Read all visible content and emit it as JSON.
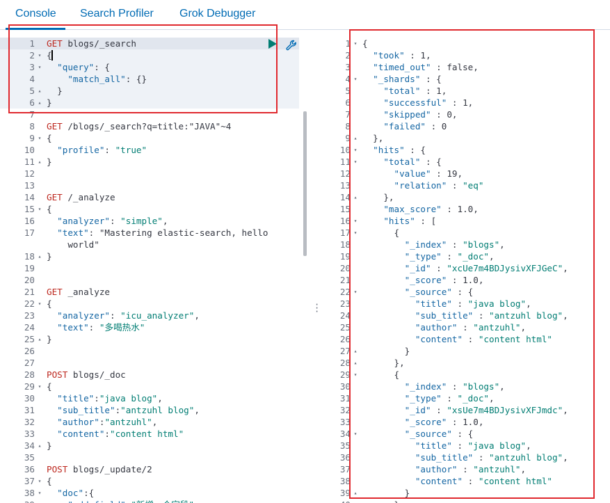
{
  "tabs": [
    {
      "label": "Console",
      "active": true
    },
    {
      "label": "Search Profiler",
      "active": false
    },
    {
      "label": "Grok Debugger",
      "active": false
    }
  ],
  "request_actions": {
    "run_icon": "play-icon",
    "settings_icon": "wrench-icon"
  },
  "colors": {
    "accent": "#006bb4",
    "method": "#bd271e",
    "string": "#017d73",
    "key": "#1466a3",
    "highlight_box": "#e0282e"
  },
  "editor": {
    "lines": [
      {
        "n": "1",
        "fold": "",
        "text": "GET blogs/_search"
      },
      {
        "n": "2",
        "fold": "▾",
        "text": "{"
      },
      {
        "n": "3",
        "fold": "▾",
        "text": "  \"query\": {"
      },
      {
        "n": "4",
        "fold": "",
        "text": "    \"match_all\": {}"
      },
      {
        "n": "5",
        "fold": "▴",
        "text": "  }"
      },
      {
        "n": "6",
        "fold": "▴",
        "text": "}"
      },
      {
        "n": "7",
        "fold": "",
        "text": ""
      },
      {
        "n": "8",
        "fold": "",
        "text": "GET /blogs/_search?q=title:\"JAVA\"~4"
      },
      {
        "n": "9",
        "fold": "▾",
        "text": "{"
      },
      {
        "n": "10",
        "fold": "",
        "text": "  \"profile\": \"true\""
      },
      {
        "n": "11",
        "fold": "▴",
        "text": "}"
      },
      {
        "n": "12",
        "fold": "",
        "text": ""
      },
      {
        "n": "13",
        "fold": "",
        "text": ""
      },
      {
        "n": "14",
        "fold": "",
        "text": "GET /_analyze"
      },
      {
        "n": "15",
        "fold": "▾",
        "text": "{"
      },
      {
        "n": "16",
        "fold": "",
        "text": "  \"analyzer\": \"simple\","
      },
      {
        "n": "17",
        "fold": "",
        "text": "  \"text\": \"Mastering elastic-search, hello"
      },
      {
        "n": "",
        "fold": "",
        "text": "    world\""
      },
      {
        "n": "18",
        "fold": "▴",
        "text": "}"
      },
      {
        "n": "19",
        "fold": "",
        "text": ""
      },
      {
        "n": "20",
        "fold": "",
        "text": ""
      },
      {
        "n": "21",
        "fold": "",
        "text": "GET _analyze"
      },
      {
        "n": "22",
        "fold": "▾",
        "text": "{"
      },
      {
        "n": "23",
        "fold": "",
        "text": "  \"analyzer\": \"icu_analyzer\","
      },
      {
        "n": "24",
        "fold": "",
        "text": "  \"text\": \"多喝热水\""
      },
      {
        "n": "25",
        "fold": "▴",
        "text": "}"
      },
      {
        "n": "26",
        "fold": "",
        "text": ""
      },
      {
        "n": "27",
        "fold": "",
        "text": ""
      },
      {
        "n": "28",
        "fold": "",
        "text": "POST blogs/_doc"
      },
      {
        "n": "29",
        "fold": "▾",
        "text": "{"
      },
      {
        "n": "30",
        "fold": "",
        "text": "  \"title\":\"java blog\","
      },
      {
        "n": "31",
        "fold": "",
        "text": "  \"sub_title\":\"antzuhl blog\","
      },
      {
        "n": "32",
        "fold": "",
        "text": "  \"author\":\"antzuhl\","
      },
      {
        "n": "33",
        "fold": "",
        "text": "  \"content\":\"content html\""
      },
      {
        "n": "34",
        "fold": "▴",
        "text": "}"
      },
      {
        "n": "35",
        "fold": "",
        "text": ""
      },
      {
        "n": "36",
        "fold": "",
        "text": "POST blogs/_update/2"
      },
      {
        "n": "37",
        "fold": "▾",
        "text": "{"
      },
      {
        "n": "38",
        "fold": "▾",
        "text": "  \"doc\":{"
      },
      {
        "n": "39",
        "fold": "",
        "text": "    \"add_field\":\"新增一个字段\""
      }
    ]
  },
  "response": {
    "lines": [
      {
        "n": "1",
        "fold": "▾",
        "text": "{"
      },
      {
        "n": "2",
        "fold": "",
        "text": "  \"took\" : 1,"
      },
      {
        "n": "3",
        "fold": "",
        "text": "  \"timed_out\" : false,"
      },
      {
        "n": "4",
        "fold": "▾",
        "text": "  \"_shards\" : {"
      },
      {
        "n": "5",
        "fold": "",
        "text": "    \"total\" : 1,"
      },
      {
        "n": "6",
        "fold": "",
        "text": "    \"successful\" : 1,"
      },
      {
        "n": "7",
        "fold": "",
        "text": "    \"skipped\" : 0,"
      },
      {
        "n": "8",
        "fold": "",
        "text": "    \"failed\" : 0"
      },
      {
        "n": "9",
        "fold": "▴",
        "text": "  },"
      },
      {
        "n": "10",
        "fold": "▾",
        "text": "  \"hits\" : {"
      },
      {
        "n": "11",
        "fold": "▾",
        "text": "    \"total\" : {"
      },
      {
        "n": "12",
        "fold": "",
        "text": "      \"value\" : 19,"
      },
      {
        "n": "13",
        "fold": "",
        "text": "      \"relation\" : \"eq\""
      },
      {
        "n": "14",
        "fold": "▴",
        "text": "    },"
      },
      {
        "n": "15",
        "fold": "",
        "text": "    \"max_score\" : 1.0,"
      },
      {
        "n": "16",
        "fold": "▾",
        "text": "    \"hits\" : ["
      },
      {
        "n": "17",
        "fold": "▾",
        "text": "      {"
      },
      {
        "n": "18",
        "fold": "",
        "text": "        \"_index\" : \"blogs\","
      },
      {
        "n": "19",
        "fold": "",
        "text": "        \"_type\" : \"_doc\","
      },
      {
        "n": "20",
        "fold": "",
        "text": "        \"_id\" : \"xcUe7m4BDJysivXFJGeC\","
      },
      {
        "n": "21",
        "fold": "",
        "text": "        \"_score\" : 1.0,"
      },
      {
        "n": "22",
        "fold": "▾",
        "text": "        \"_source\" : {"
      },
      {
        "n": "23",
        "fold": "",
        "text": "          \"title\" : \"java blog\","
      },
      {
        "n": "24",
        "fold": "",
        "text": "          \"sub_title\" : \"antzuhl blog\","
      },
      {
        "n": "25",
        "fold": "",
        "text": "          \"author\" : \"antzuhl\","
      },
      {
        "n": "26",
        "fold": "",
        "text": "          \"content\" : \"content html\""
      },
      {
        "n": "27",
        "fold": "▴",
        "text": "        }"
      },
      {
        "n": "28",
        "fold": "▴",
        "text": "      },"
      },
      {
        "n": "29",
        "fold": "▾",
        "text": "      {"
      },
      {
        "n": "30",
        "fold": "",
        "text": "        \"_index\" : \"blogs\","
      },
      {
        "n": "31",
        "fold": "",
        "text": "        \"_type\" : \"_doc\","
      },
      {
        "n": "32",
        "fold": "",
        "text": "        \"_id\" : \"xsUe7m4BDJysivXFJmdc\","
      },
      {
        "n": "33",
        "fold": "",
        "text": "        \"_score\" : 1.0,"
      },
      {
        "n": "34",
        "fold": "▾",
        "text": "        \"_source\" : {"
      },
      {
        "n": "35",
        "fold": "",
        "text": "          \"title\" : \"java blog\","
      },
      {
        "n": "36",
        "fold": "",
        "text": "          \"sub_title\" : \"antzuhl blog\","
      },
      {
        "n": "37",
        "fold": "",
        "text": "          \"author\" : \"antzuhl\","
      },
      {
        "n": "38",
        "fold": "",
        "text": "          \"content\" : \"content html\""
      },
      {
        "n": "39",
        "fold": "▴",
        "text": "        }"
      },
      {
        "n": "40",
        "fold": "",
        "text": "      },"
      }
    ]
  }
}
